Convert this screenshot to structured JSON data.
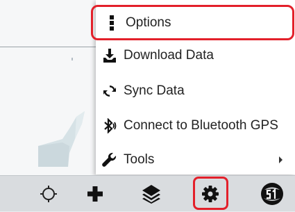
{
  "menu": {
    "items": [
      {
        "label": "Options",
        "icon": "vertical-dots-icon"
      },
      {
        "label": "Download Data",
        "icon": "download-icon"
      },
      {
        "label": "Sync Data",
        "icon": "sync-icon"
      },
      {
        "label": "Connect to Bluetooth GPS",
        "icon": "bluetooth-icon"
      },
      {
        "label": "Tools",
        "icon": "wrench-icon",
        "submenu": true
      }
    ]
  },
  "toolbar": {
    "items": [
      {
        "icon": "gps-target-icon"
      },
      {
        "icon": "add-icon"
      },
      {
        "icon": "layers-icon"
      },
      {
        "icon": "gear-icon",
        "highlighted": true
      },
      {
        "icon": "brand-logo-icon"
      }
    ]
  },
  "colors": {
    "highlight": "#e3202a",
    "menu_background": "#ffffff",
    "toolbar_background": "#d9dcdf",
    "map_water": "#d6e2e6"
  }
}
